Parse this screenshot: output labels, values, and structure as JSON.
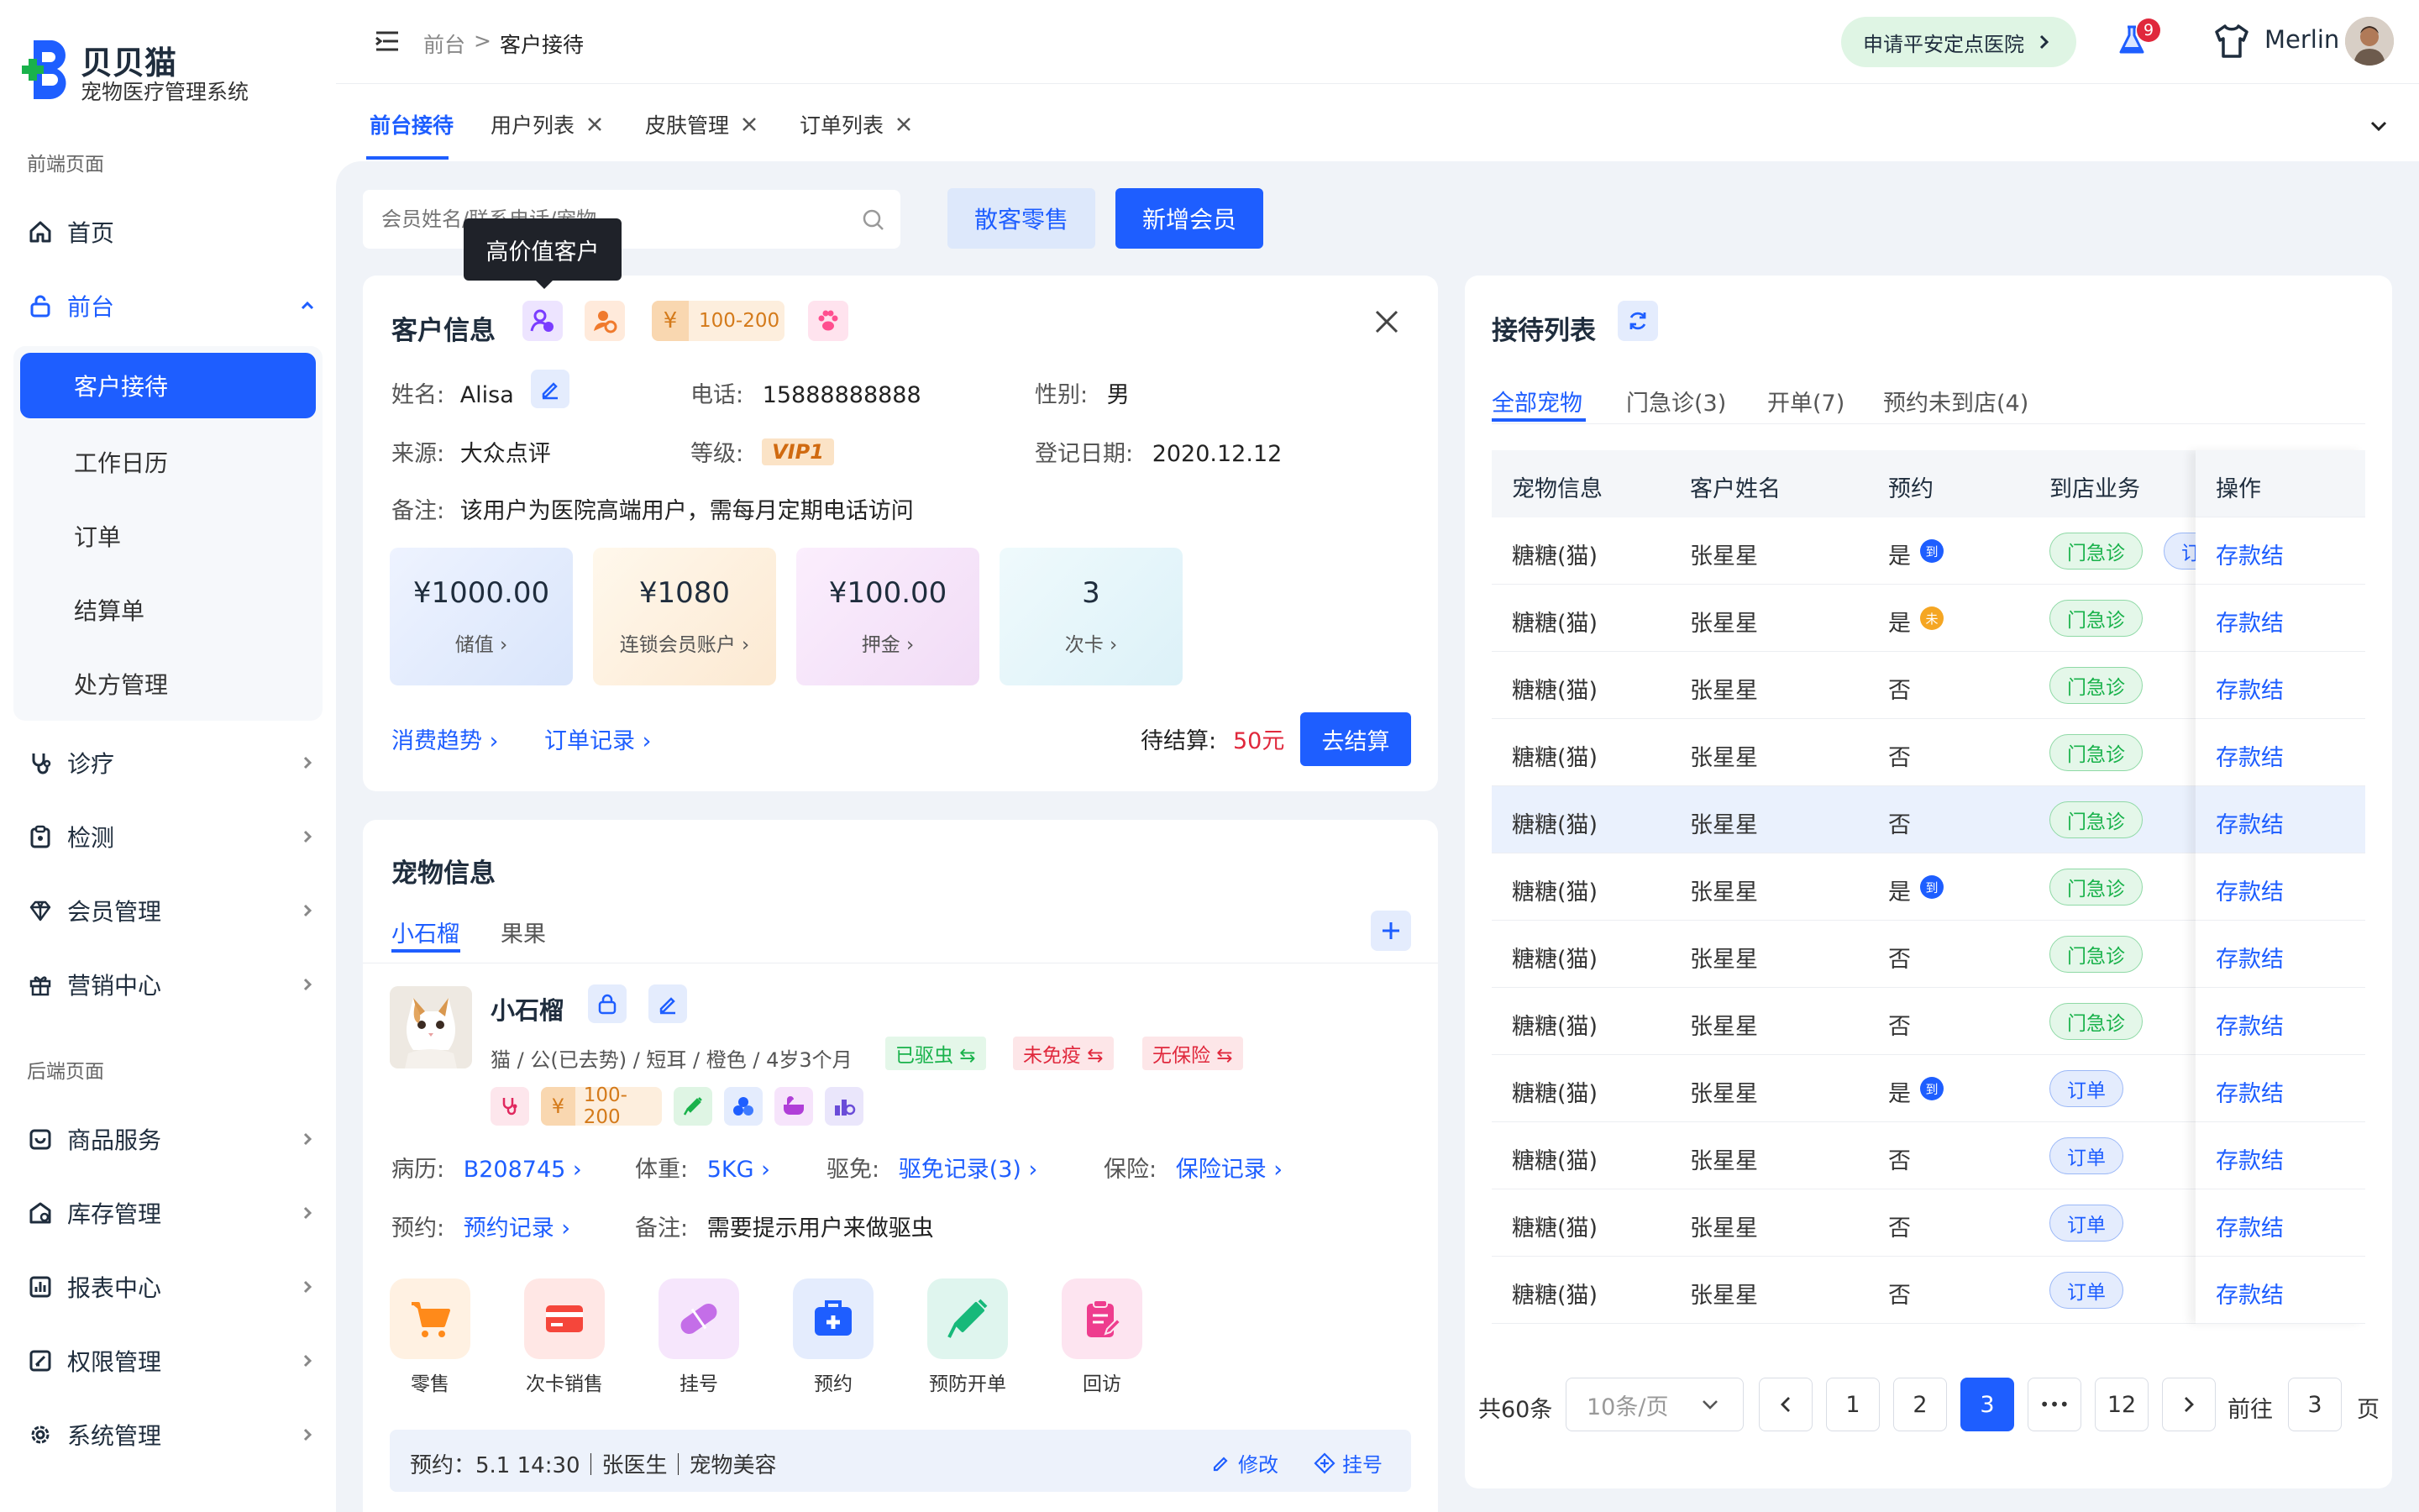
{
  "brand": {
    "title": "贝贝猫",
    "subtitle": "宠物医疗管理系统"
  },
  "sidebar": {
    "front_section": "前端页面",
    "back_section": "后端页面",
    "home": "首页",
    "front_desk": "前台",
    "sub": [
      "客户接待",
      "工作日历",
      "订单",
      "结算单",
      "处方管理"
    ],
    "items": [
      "诊疗",
      "检测",
      "会员管理",
      "营销中心"
    ],
    "back_items": [
      "商品服务",
      "库存管理",
      "报表中心",
      "权限管理",
      "系统管理"
    ]
  },
  "topbar": {
    "breadcrumb_root": "前台",
    "breadcrumb_sep": ">",
    "breadcrumb_current": "客户接待",
    "apply_btn": "申请平安定点医院",
    "badge": "9",
    "user": "Merlin"
  },
  "tabs": [
    "前台接待",
    "用户列表",
    "皮肤管理",
    "订单列表"
  ],
  "search": {
    "placeholder": "会员姓名/联系电话/宠物",
    "btn_walkin": "散客零售",
    "btn_new": "新增会员"
  },
  "tooltip": "高价值客户",
  "customer": {
    "title": "客户信息",
    "price_tag": "100-200",
    "name_label": "姓名:",
    "name": "Alisa",
    "phone_label": "电话:",
    "phone": "15888888888",
    "gender_label": "性别:",
    "gender": "男",
    "source_label": "来源:",
    "source": "大众点评",
    "level_label": "等级:",
    "level": "VIP1",
    "date_label": "登记日期:",
    "date": "2020.12.12",
    "note_label": "备注:",
    "note": "该用户为医院高端用户，需每月定期电话访问",
    "stats": [
      {
        "value": "¥1000.00",
        "label": "储值 ›"
      },
      {
        "value": "¥1080",
        "label": "连锁会员账户 ›"
      },
      {
        "value": "¥100.00",
        "label": "押金 ›"
      },
      {
        "value": "3",
        "label": "次卡 ›"
      }
    ],
    "link_trend": "消费趋势 ›",
    "link_orders": "订单记录 ›",
    "pending_label": "待结算:",
    "pending_value": "50元",
    "settle_btn": "去结算"
  },
  "pet": {
    "title": "宠物信息",
    "tabs": [
      "小石榴",
      "果果"
    ],
    "name": "小石榴",
    "desc": "猫 / 公(已去势) / 短耳 / 橙色 / 4岁3个月",
    "tags": [
      "已驱虫 ⇆",
      "未免疫 ⇆",
      "无保险 ⇆"
    ],
    "price_tag": "100-200",
    "history_label": "病历:",
    "history": "B208745 ›",
    "weight_label": "体重:",
    "weight": "5KG ›",
    "deworm_label": "驱免:",
    "deworm": "驱免记录(3) ›",
    "insurance_label": "保险:",
    "insurance": "保险记录 ›",
    "appt_label": "预约:",
    "appt": "预约记录 ›",
    "note_label": "备注:",
    "note": "需要提示用户来做驱虫",
    "actions": [
      "零售",
      "次卡销售",
      "挂号",
      "预约",
      "预防开单",
      "回访"
    ],
    "footer": "预约：5.1 14:30｜张医生｜宠物美容",
    "footer_edit": "修改",
    "footer_reg": "挂号"
  },
  "reception": {
    "title": "接待列表",
    "tabs": [
      "全部宠物",
      "门急诊(3)",
      "开单(7)",
      "预约未到店(4)"
    ],
    "headers": [
      "宠物信息",
      "客户姓名",
      "预约",
      "到店业务",
      "操作"
    ],
    "rows": [
      {
        "pet": "糖糖(猫)",
        "owner": "张星星",
        "appt": "是",
        "mark": "到",
        "biz": "门急诊",
        "op": "存款结"
      },
      {
        "pet": "糖糖(猫)",
        "owner": "张星星",
        "appt": "是",
        "mark": "未",
        "biz": "门急诊",
        "op": "存款结"
      },
      {
        "pet": "糖糖(猫)",
        "owner": "张星星",
        "appt": "否",
        "mark": "",
        "biz": "门急诊",
        "op": "存款结"
      },
      {
        "pet": "糖糖(猫)",
        "owner": "张星星",
        "appt": "否",
        "mark": "",
        "biz": "门急诊",
        "op": "存款结"
      },
      {
        "pet": "糖糖(猫)",
        "owner": "张星星",
        "appt": "否",
        "mark": "",
        "biz": "门急诊",
        "op": "存款结"
      },
      {
        "pet": "糖糖(猫)",
        "owner": "张星星",
        "appt": "是",
        "mark": "到",
        "biz": "门急诊",
        "op": "存款结"
      },
      {
        "pet": "糖糖(猫)",
        "owner": "张星星",
        "appt": "否",
        "mark": "",
        "biz": "门急诊",
        "op": "存款结"
      },
      {
        "pet": "糖糖(猫)",
        "owner": "张星星",
        "appt": "否",
        "mark": "",
        "biz": "门急诊",
        "op": "存款结"
      },
      {
        "pet": "糖糖(猫)",
        "owner": "张星星",
        "appt": "是",
        "mark": "到",
        "biz": "订单",
        "op": "存款结"
      },
      {
        "pet": "糖糖(猫)",
        "owner": "张星星",
        "appt": "否",
        "mark": "",
        "biz": "订单",
        "op": "存款结"
      },
      {
        "pet": "糖糖(猫)",
        "owner": "张星星",
        "appt": "否",
        "mark": "",
        "biz": "订单",
        "op": "存款结"
      },
      {
        "pet": "糖糖(猫)",
        "owner": "张星星",
        "appt": "否",
        "mark": "",
        "biz": "订单",
        "op": "存款结"
      }
    ],
    "extra_tag": "订",
    "total": "共60条",
    "page_size": "10条/页",
    "pages": [
      "1",
      "2",
      "3",
      "•••",
      "12"
    ],
    "goto_label": "前往",
    "goto_value": "3",
    "page_unit": "页"
  },
  "colors": {
    "accent": "#1e5eff",
    "price": "#e0283c",
    "green": "#19b24b",
    "active_row": "#eaf1fd"
  }
}
